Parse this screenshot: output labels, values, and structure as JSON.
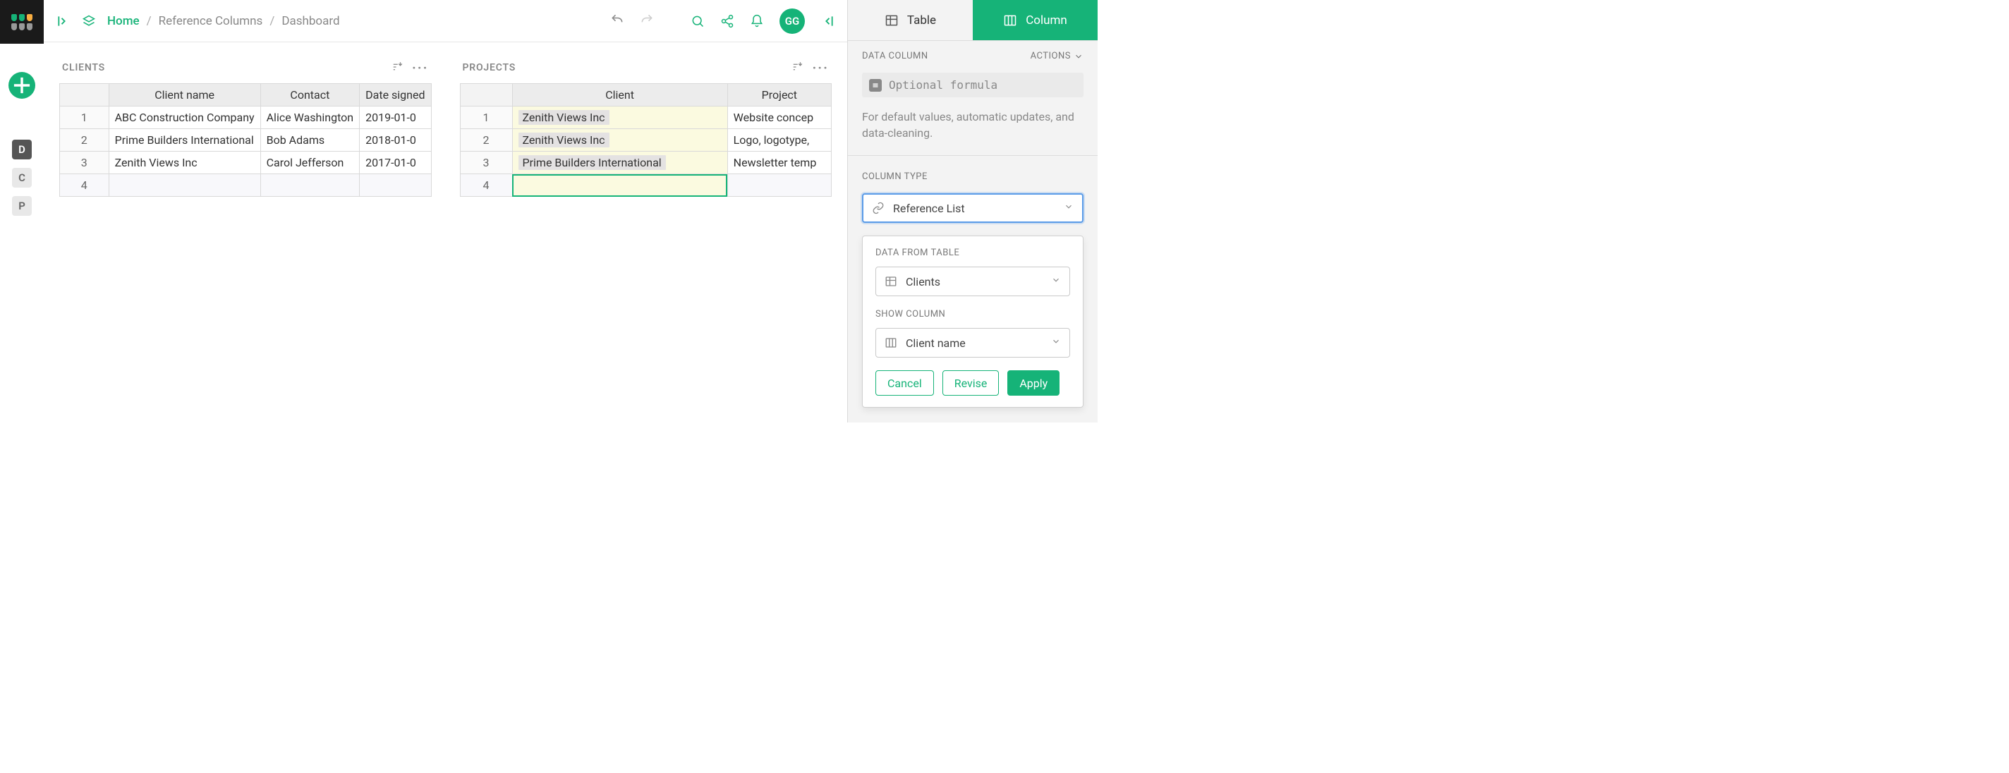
{
  "breadcrumb": {
    "home": "Home",
    "mid": "Reference Columns",
    "leaf": "Dashboard"
  },
  "avatar": "GG",
  "sidebar_pages": [
    "D",
    "C",
    "P"
  ],
  "clients_table": {
    "title": "CLIENTS",
    "columns": [
      "Client name",
      "Contact",
      "Date signed"
    ],
    "rows": [
      {
        "n": "1",
        "name": "ABC Construction Company",
        "contact": "Alice Washington",
        "date": "2019-01-0"
      },
      {
        "n": "2",
        "name": "Prime Builders International",
        "contact": "Bob Adams",
        "date": "2018-01-0"
      },
      {
        "n": "3",
        "name": "Zenith Views Inc",
        "contact": "Carol Jefferson",
        "date": "2017-01-0"
      }
    ],
    "addrow": "4"
  },
  "projects_table": {
    "title": "PROJECTS",
    "columns": [
      "Client",
      "Project"
    ],
    "rows": [
      {
        "n": "1",
        "client": "Zenith Views Inc",
        "project": "Website concep"
      },
      {
        "n": "2",
        "client": "Zenith Views Inc",
        "project": "Logo, logotype,"
      },
      {
        "n": "3",
        "client": "Prime Builders International",
        "project": "Newsletter temp"
      }
    ],
    "addrow": "4"
  },
  "panel": {
    "tab_table": "Table",
    "tab_column": "Column",
    "data_column": "DATA COLUMN",
    "actions": "ACTIONS",
    "formula_placeholder": "Optional formula",
    "hint": "For default values, automatic updates, and data-cleaning.",
    "column_type_label": "COLUMN TYPE",
    "column_type_value": "Reference List",
    "data_from_table_label": "DATA FROM TABLE",
    "data_from_table_value": "Clients",
    "show_column_label": "SHOW COLUMN",
    "show_column_value": "Client name",
    "cancel": "Cancel",
    "revise": "Revise",
    "apply": "Apply"
  }
}
